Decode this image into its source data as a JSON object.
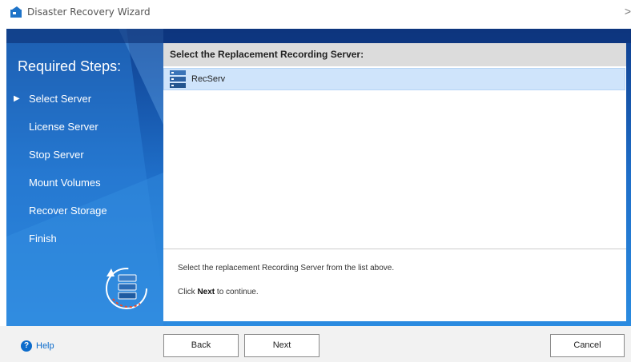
{
  "window": {
    "title": "Disaster Recovery Wizard",
    "close_glyph": ">"
  },
  "sidebar": {
    "heading": "Required Steps:",
    "current_marker": "▶",
    "steps": [
      "Select Server",
      "License Server",
      "Stop Server",
      "Mount Volumes",
      "Recover Storage",
      "Finish"
    ],
    "current_step_index": 0
  },
  "panel": {
    "header": "Select the Replacement Recording Server:",
    "servers": [
      {
        "name": "RecServ",
        "selected": true,
        "icon": "server-icon"
      }
    ],
    "instruction": "Select the replacement Recording Server from the list above.",
    "continue_prefix": "Click",
    "continue_bold": "Next",
    "continue_suffix": "to continue."
  },
  "footer": {
    "help_label": "Help",
    "back_label": "Back",
    "next_label": "Next",
    "cancel_label": "Cancel"
  },
  "colors": {
    "accent_blue": "#1e6fc5",
    "selection": "#cfe4fb",
    "help_blue": "#0b6bcb"
  }
}
